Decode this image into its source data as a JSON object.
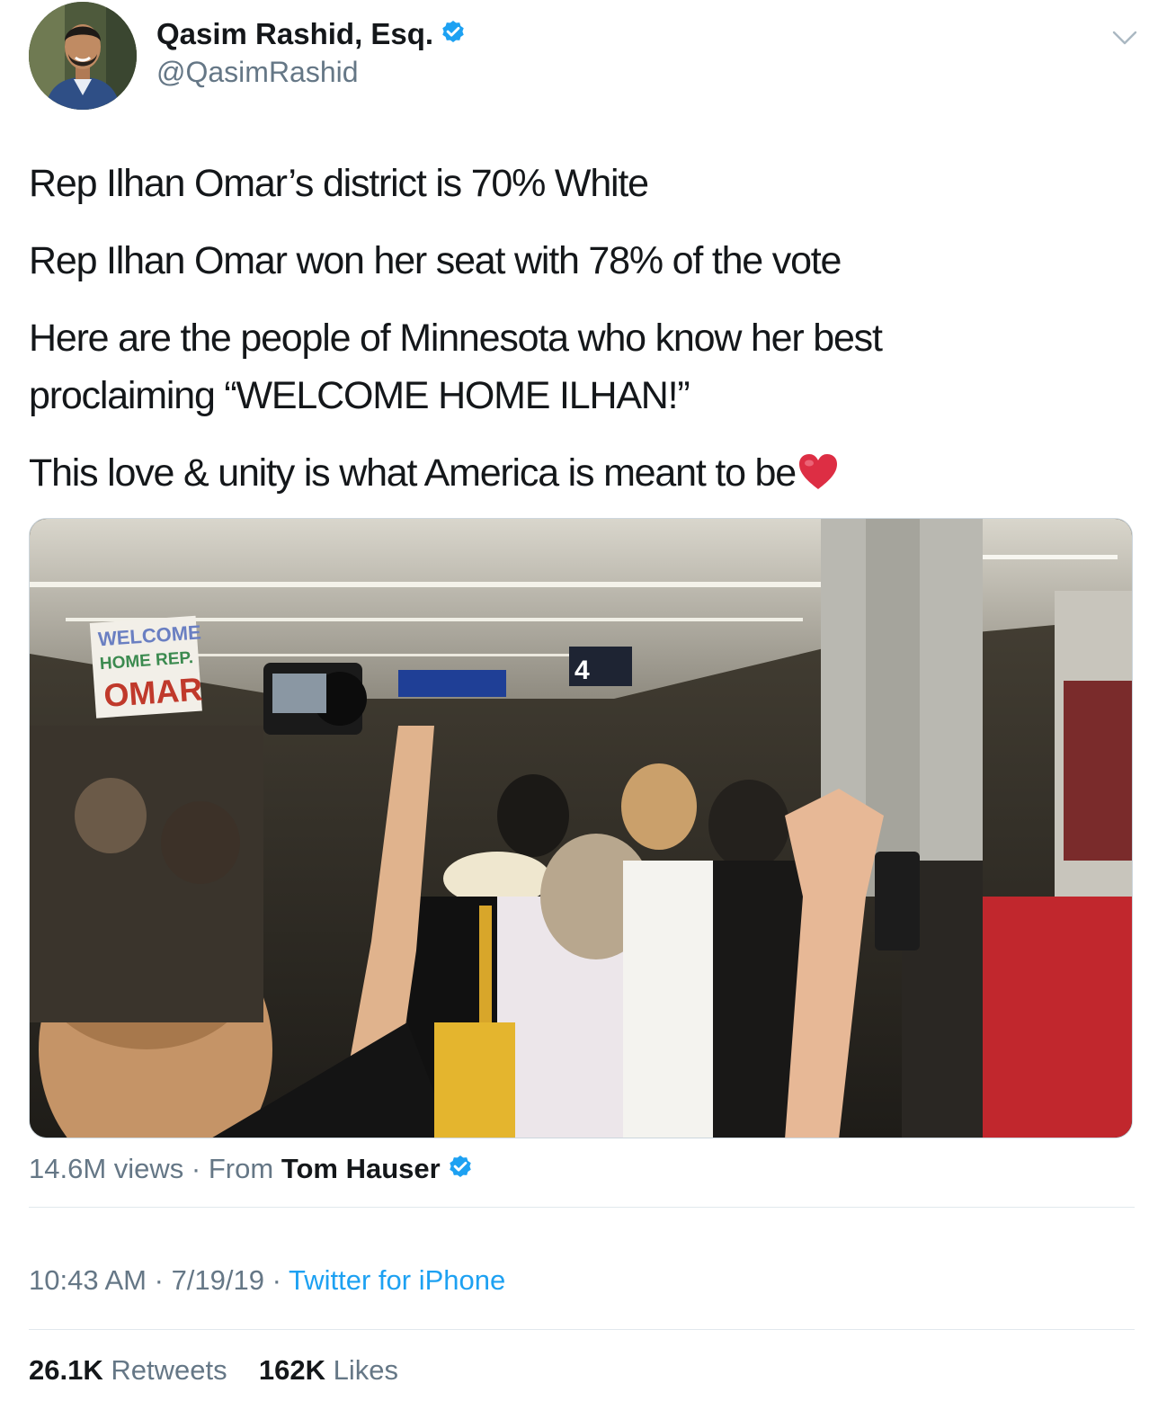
{
  "author": {
    "display_name": "Qasim Rashid, Esq.",
    "handle": "@QasimRashid",
    "verified": true,
    "avatar_icon": "profile-photo"
  },
  "menu": {
    "icon": "chevron-down-icon"
  },
  "tweet": {
    "lines": [
      "Rep Ilhan Omar’s district is 70% White",
      "Rep Ilhan Omar won her seat with 78% of the vote",
      "Here are the people of Minnesota who know her best proclaiming “WELCOME HOME ILHAN!”",
      "This love & unity is what America is meant to be"
    ],
    "emoji": "red-heart-icon"
  },
  "media": {
    "type": "video",
    "sign_text": [
      "WELCOME",
      "HOME REP.",
      "OMAR"
    ],
    "gate_sign": "4"
  },
  "video_meta": {
    "views": "14.6M views",
    "separator": "·",
    "from_label": "From",
    "from_author": "Tom Hauser",
    "from_verified": true
  },
  "timestamp": {
    "time": "10:43 AM",
    "date": "7/19/19",
    "separator": "·",
    "source": "Twitter for iPhone"
  },
  "stats": {
    "retweets_count": "26.1K",
    "retweets_label": "Retweets",
    "likes_count": "162K",
    "likes_label": "Likes"
  },
  "colors": {
    "text": "#14171a",
    "secondary": "#657786",
    "link": "#1da1f2",
    "verified": "#1da1f2",
    "divider": "#e1e8ed"
  }
}
